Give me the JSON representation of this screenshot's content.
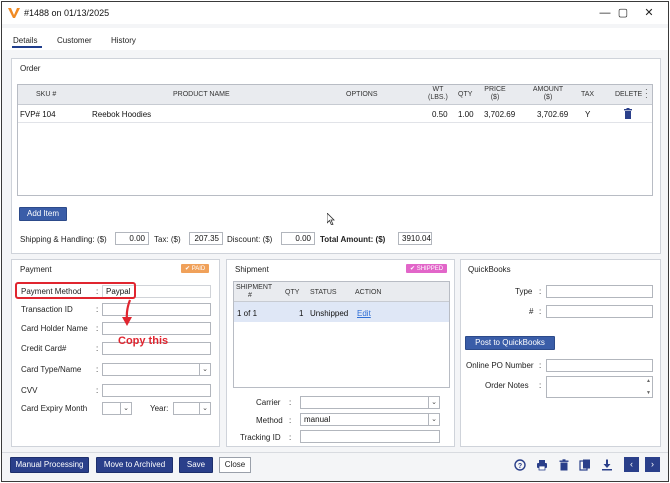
{
  "window": {
    "title": "#1488 on 01/13/2025"
  },
  "tabs": [
    "Details",
    "Customer",
    "History"
  ],
  "order": {
    "section_title": "Order",
    "columns": {
      "sku": "SKU #",
      "product": "PRODUCT NAME",
      "options": "OPTIONS",
      "wt1": "WT",
      "wt2": "(LBS.)",
      "qty": "QTY",
      "price1": "PRICE",
      "price2": "($)",
      "amount1": "AMOUNT",
      "amount2": "($)",
      "tax": "TAX",
      "delete": "DELETE"
    },
    "rows": [
      {
        "sku": "FVP# 104",
        "product": "Reebok Hoodies",
        "wt": "0.50",
        "qty": "1.00",
        "price": "3,702.69",
        "amount": "3,702.69",
        "tax": "Y"
      }
    ],
    "add_item_label": "Add Item",
    "shipping_label": "Shipping & Handling: ($)",
    "shipping_value": "0.00",
    "tax_label": "Tax: ($)",
    "tax_value": "207.35",
    "discount_label": "Discount: ($)",
    "discount_value": "0.00",
    "total_label": "Total Amount: ($)",
    "total_value": "3910.04"
  },
  "payment": {
    "section_title": "Payment",
    "badge": "✔ PAID",
    "method_label": "Payment Method",
    "method_sep": ":",
    "method_value": "Paypal",
    "transaction_label": "Transaction ID",
    "holder_label": "Card Holder Name",
    "card_label": "Credit Card#",
    "card_type_label": "Card Type/Name",
    "cvv_label": "CVV",
    "expiry_label": "Card Expiry Month",
    "year_label": "Year:",
    "sep": ":"
  },
  "shipment": {
    "section_title": "Shipment",
    "badge": "✔ SHIPPED",
    "columns": {
      "shipment1": "SHIPMENT",
      "shipment2": "#",
      "qty": "QTY",
      "status": "STATUS",
      "action": "ACTION"
    },
    "rows": [
      {
        "shipment": "1 of 1",
        "qty": "1",
        "status": "Unshipped",
        "action": "Edit"
      }
    ],
    "carrier_label": "Carrier",
    "method_label": "Method",
    "method_value": "manual",
    "tracking_label": "Tracking ID",
    "sep": ":"
  },
  "quickbooks": {
    "section_title": "QuickBooks",
    "type_label": "Type",
    "num_label": "#",
    "post_label": "Post to QuickBooks",
    "po_label": "Online PO Number",
    "notes_label": "Order Notes",
    "sep": ":"
  },
  "footer": {
    "manual_label": "Manual Processing",
    "archive_label": "Move to Archived",
    "save_label": "Save",
    "close_label": "Close"
  },
  "annotation": {
    "text": "Copy this"
  },
  "colors": {
    "accent": "#2a3f8a",
    "paid": "#f0a15a",
    "shipped": "#e266c9",
    "annotation": "#e0252f"
  }
}
